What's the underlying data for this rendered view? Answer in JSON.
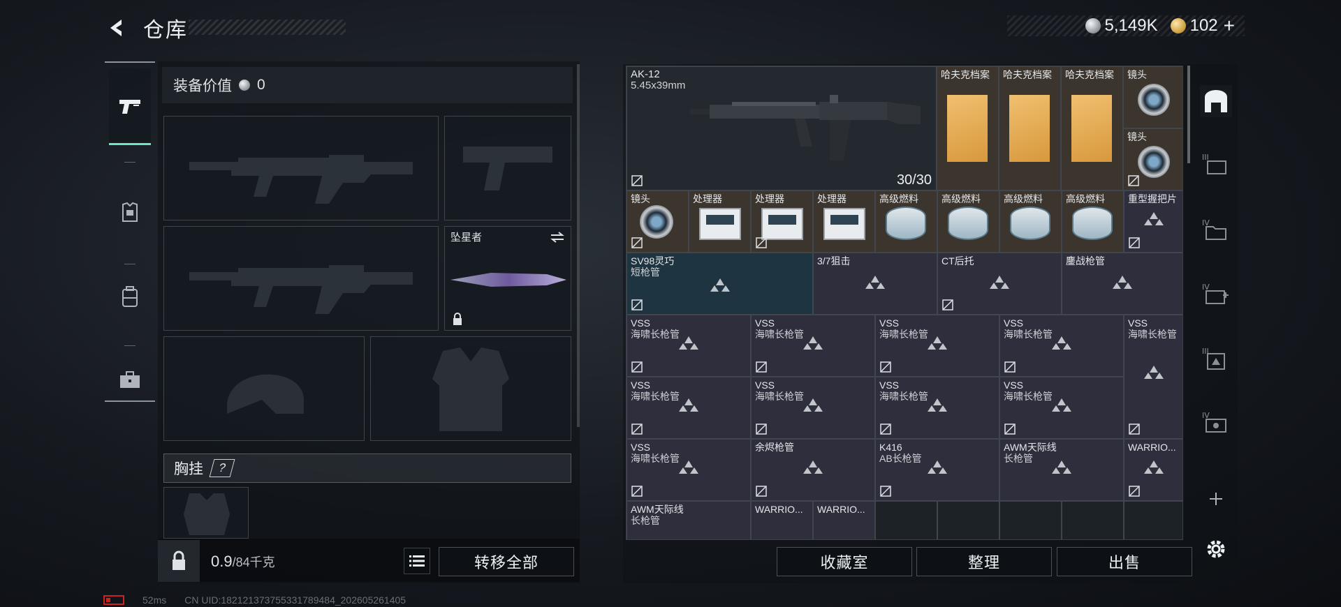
{
  "header": {
    "title": "仓库"
  },
  "currency": {
    "silver": "5,149K",
    "gold": "102"
  },
  "equipment": {
    "header_label": "装备价值",
    "header_value": "0",
    "melee_name": "坠星者",
    "chest_label": "胸挂",
    "chest_help": "?",
    "weight_value": "0.9",
    "weight_max": "/84千克",
    "transfer_all": "转移全部"
  },
  "grid": {
    "weapon": {
      "name": "AK-12",
      "caliber": "5.45x39mm",
      "ammo": "30/30"
    },
    "row1": [
      "哈夫克档案",
      "哈夫克档案",
      "哈夫克档案"
    ],
    "scope_top": "镜头",
    "scope_bottom": "镜头",
    "row2": [
      "镜头",
      "处理器",
      "处理器",
      "处理器",
      "高级燃料",
      "高级燃料",
      "高级燃料",
      "高级燃料",
      "重型握把片"
    ],
    "row3": [
      {
        "n1": "SV98灵巧",
        "n2": "短枪管"
      },
      {
        "n1": "3/7狙击",
        "n2": ""
      },
      {
        "n1": "CT后托",
        "n2": ""
      },
      {
        "n1": "鏖战枪管",
        "n2": ""
      }
    ],
    "row4": [
      {
        "n1": "VSS",
        "n2": "海啸长枪管"
      },
      {
        "n1": "VSS",
        "n2": "海啸长枪管"
      },
      {
        "n1": "VSS",
        "n2": "海啸长枪管"
      },
      {
        "n1": "VSS",
        "n2": "海啸长枪管"
      },
      {
        "n1": "VSS",
        "n2": "海啸长枪管"
      }
    ],
    "row5": [
      {
        "n1": "VSS",
        "n2": "海啸长枪管"
      },
      {
        "n1": "VSS",
        "n2": "海啸长枪管"
      },
      {
        "n1": "VSS",
        "n2": "海啸长枪管"
      },
      {
        "n1": "VSS",
        "n2": "海啸长枪管"
      }
    ],
    "row6": [
      {
        "n1": "VSS",
        "n2": "海啸长枪管"
      },
      {
        "n1": "余烬枪管",
        "n2": ""
      },
      {
        "n1": "K416",
        "n2": "AB长枪管"
      },
      {
        "n1": "AWM天际线",
        "n2": "长枪管"
      },
      {
        "n1": "WARRIO...",
        "n2": ""
      }
    ],
    "row7": [
      {
        "n1": "AWM天际线",
        "n2": "长枪管"
      },
      {
        "n1": "WARRIO...",
        "n2": ""
      },
      {
        "n1": "WARRIO...",
        "n2": ""
      }
    ]
  },
  "actions": {
    "collection": "收藏室",
    "organize": "整理",
    "sell": "出售"
  },
  "status": {
    "ping": "52ms",
    "uid": "CN UID:1821213737553317894​84_202605261405"
  },
  "colors": {
    "accent": "#6fe6c0",
    "tan_cell": "#3c352d",
    "purple_cell": "#2f2e3d"
  }
}
